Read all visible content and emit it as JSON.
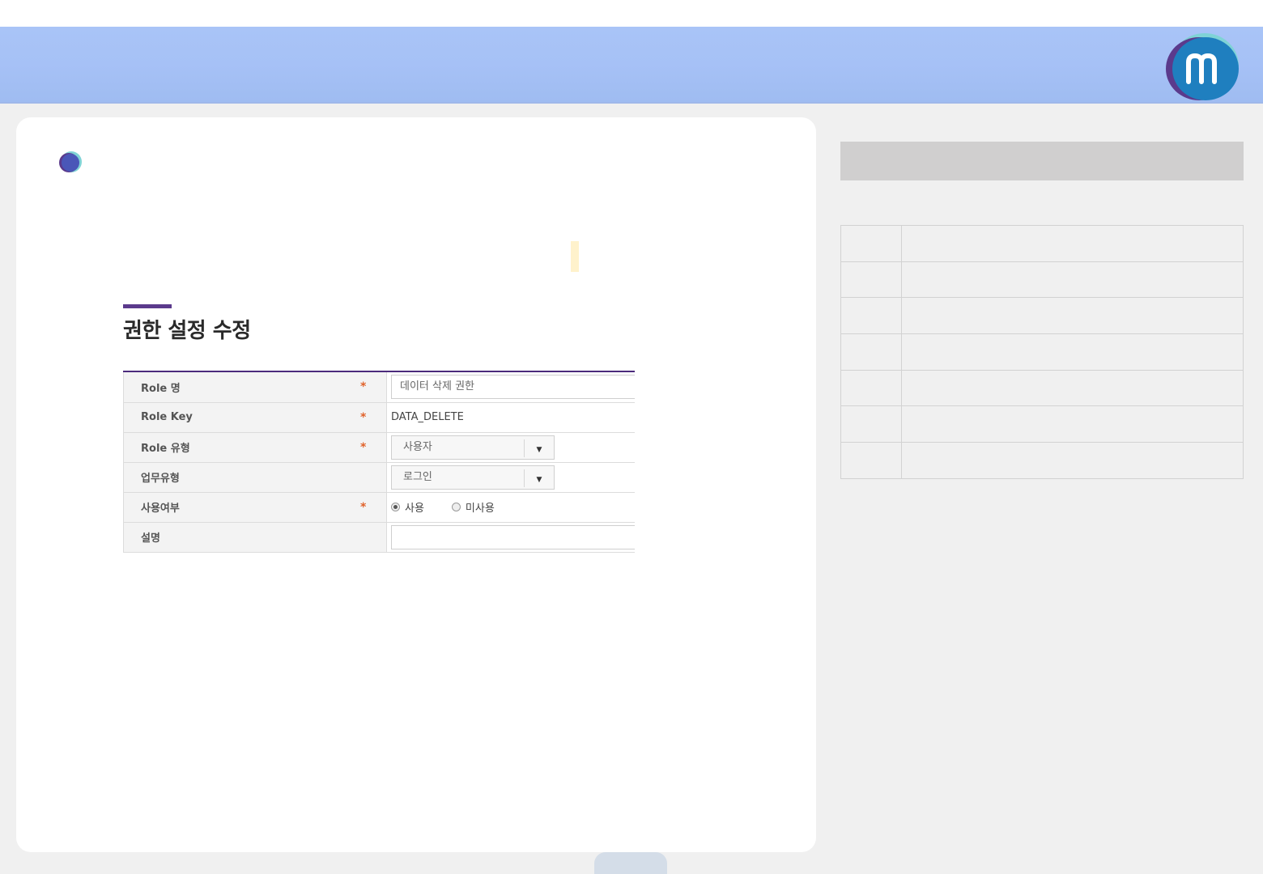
{
  "header": {
    "logo_icon": "m-circle-logo-icon",
    "colors": {
      "bar": "#a6c1f6",
      "logo_main": "#1f7fbf",
      "logo_accent": "#5b3a8c"
    }
  },
  "page": {
    "title": "권한 설정 수정",
    "title_accent_color": "#5b3a8c"
  },
  "form": {
    "rows": [
      {
        "label": "Role 명",
        "required": "*",
        "value": "데이터 삭제 권한"
      },
      {
        "label": "Role Key",
        "required": "*",
        "value": "DATA_DELETE"
      },
      {
        "label": "Role 유형",
        "required": "*",
        "value": "사용자"
      },
      {
        "label": "업무유형",
        "required": "",
        "value": "로그인"
      },
      {
        "label": "사용여부",
        "required": "*",
        "options": [
          "사용",
          "미사용"
        ],
        "selected": "사용"
      },
      {
        "label": "설명",
        "required": "",
        "value": ""
      }
    ],
    "required_color": "#e0622a"
  },
  "right_panel": {
    "rows": 7,
    "header_color": "#d0cfcf"
  }
}
